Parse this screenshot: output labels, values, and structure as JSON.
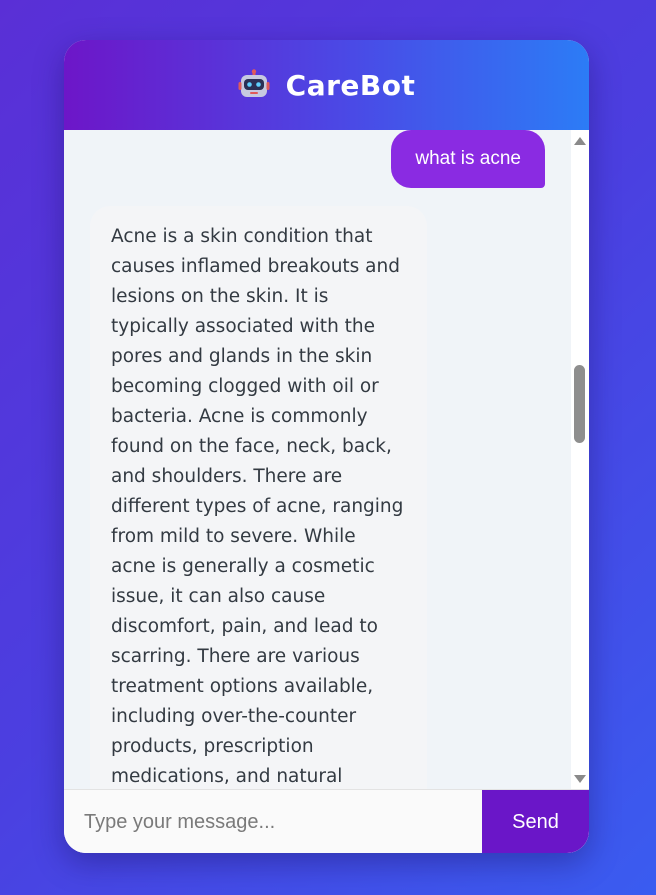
{
  "header": {
    "title": "CareBot",
    "icon": "robot-icon"
  },
  "messages": [
    {
      "role": "user",
      "text": "what is acne"
    },
    {
      "role": "bot",
      "text": "Acne is a skin condition that causes inflamed breakouts and lesions on the skin. It is typically associated with the pores and glands in the skin becoming clogged with oil or bacteria. Acne is commonly found on the face, neck, back, and shoulders. There are different types of acne, ranging from mild to severe. While acne is generally a cosmetic issue, it can also cause discomfort, pain, and lead to scarring. There are various treatment options available, including over-the-counter products, prescription medications, and natural remedies."
    }
  ],
  "input": {
    "placeholder": "Type your message...",
    "value": ""
  },
  "send_label": "Send",
  "colors": {
    "user_bubble": "#8a2be2",
    "send_button": "#6a16c8",
    "header_start": "#6d16c8",
    "header_end": "#2c7cf6"
  }
}
